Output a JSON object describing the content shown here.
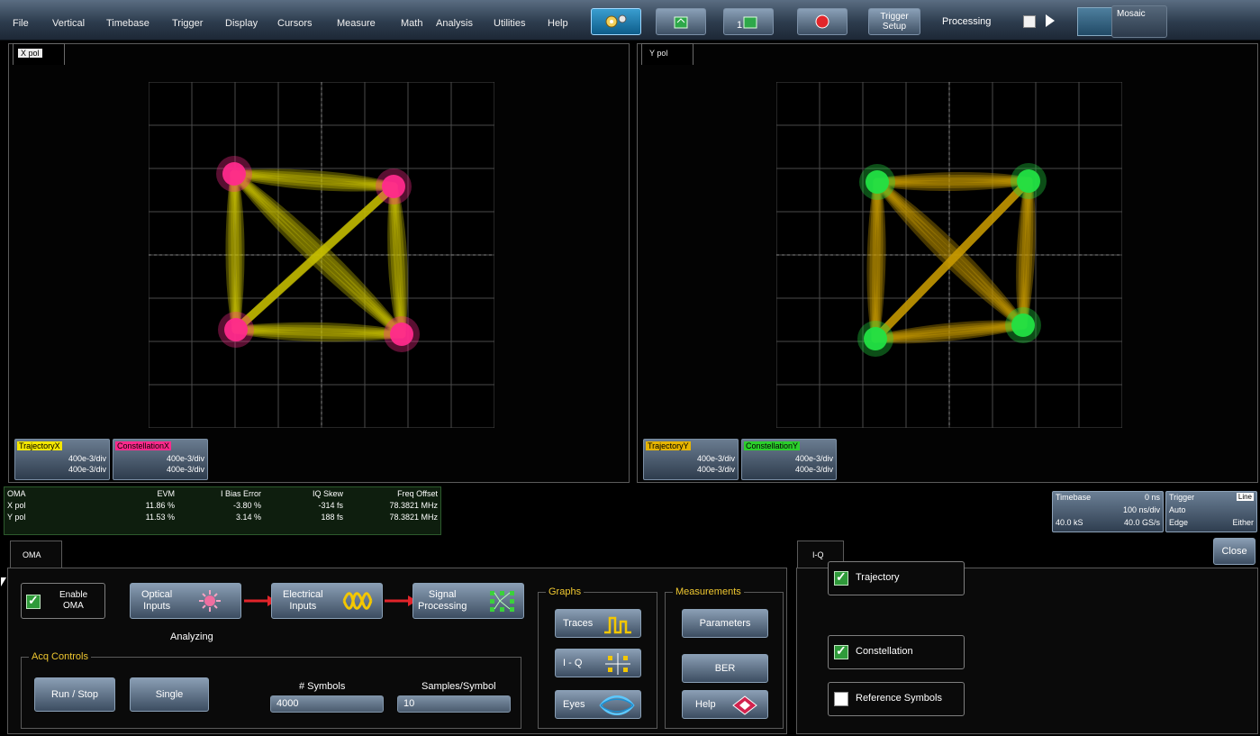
{
  "menu": [
    "File",
    "Vertical",
    "Timebase",
    "Trigger",
    "Display",
    "Cursors",
    "Measure",
    "Math",
    "Analysis",
    "Utilities",
    "Help"
  ],
  "toolbar": {
    "trigger_setup": [
      "Trigger",
      "Setup"
    ],
    "processing": "Processing",
    "mosaic": "Mosaic"
  },
  "panels": [
    {
      "tab": "X pol",
      "traces": [
        {
          "name": "TrajectoryX",
          "scale1": "400e-3/div",
          "scale2": "400e-3/div",
          "color": "#f4e600"
        },
        {
          "name": "ConstellationX",
          "scale1": "400e-3/div",
          "scale2": "400e-3/div",
          "color": "#ff2a8c"
        }
      ],
      "trajectory_color": "#c8c000",
      "constellation_color": "#ff2a8c"
    },
    {
      "tab": "Y pol",
      "traces": [
        {
          "name": "TrajectoryY",
          "scale1": "400e-3/div",
          "scale2": "400e-3/div",
          "color": "#e6b400"
        },
        {
          "name": "ConstellationY",
          "scale1": "400e-3/div",
          "scale2": "400e-3/div",
          "color": "#2ccf2c"
        }
      ],
      "trajectory_color": "#c89a00",
      "constellation_color": "#22e043"
    }
  ],
  "measurements": {
    "headers": [
      "OMA",
      "EVM",
      "I Bias Error",
      "IQ Skew",
      "Freq Offset"
    ],
    "rows": [
      [
        "X pol",
        "11.86 %",
        "-3.80 %",
        "-314 fs",
        "78.3821 MHz"
      ],
      [
        "Y pol",
        "11.53 %",
        "3.14 %",
        "188 fs",
        "78.3821 MHz"
      ]
    ]
  },
  "timebase": {
    "title": "Timebase",
    "delay": "0 ns",
    "per_div": "100 ns/div",
    "samples": "40.0 kS",
    "rate": "40.0 GS/s"
  },
  "trigger": {
    "title": "Trigger",
    "badge": "Line",
    "mode": "Auto",
    "type": "Edge",
    "slope": "Either"
  },
  "oma_dialog": {
    "tab": "OMA",
    "enable": [
      "Enable",
      "OMA"
    ],
    "optical": [
      "Optical",
      "Inputs"
    ],
    "electrical": [
      "Electrical",
      "Inputs"
    ],
    "signal": [
      "Signal",
      "Processing"
    ],
    "status": "Analyzing",
    "acq_title": "Acq Controls",
    "run_stop": "Run / Stop",
    "single": "Single",
    "symbols_label": "# Symbols",
    "symbols_value": "4000",
    "sps_label": "Samples/Symbol",
    "sps_value": "10",
    "graphs_title": "Graphs",
    "traces": "Traces",
    "iq": "I - Q",
    "eyes": "Eyes",
    "meas_title": "Measurements",
    "parameters": "Parameters",
    "ber": "BER",
    "help": "Help"
  },
  "iq_dialog": {
    "tab": "I-Q",
    "close": "Close",
    "trajectory": "Trajectory",
    "constellation": "Constellation",
    "reference": "Reference Symbols"
  }
}
